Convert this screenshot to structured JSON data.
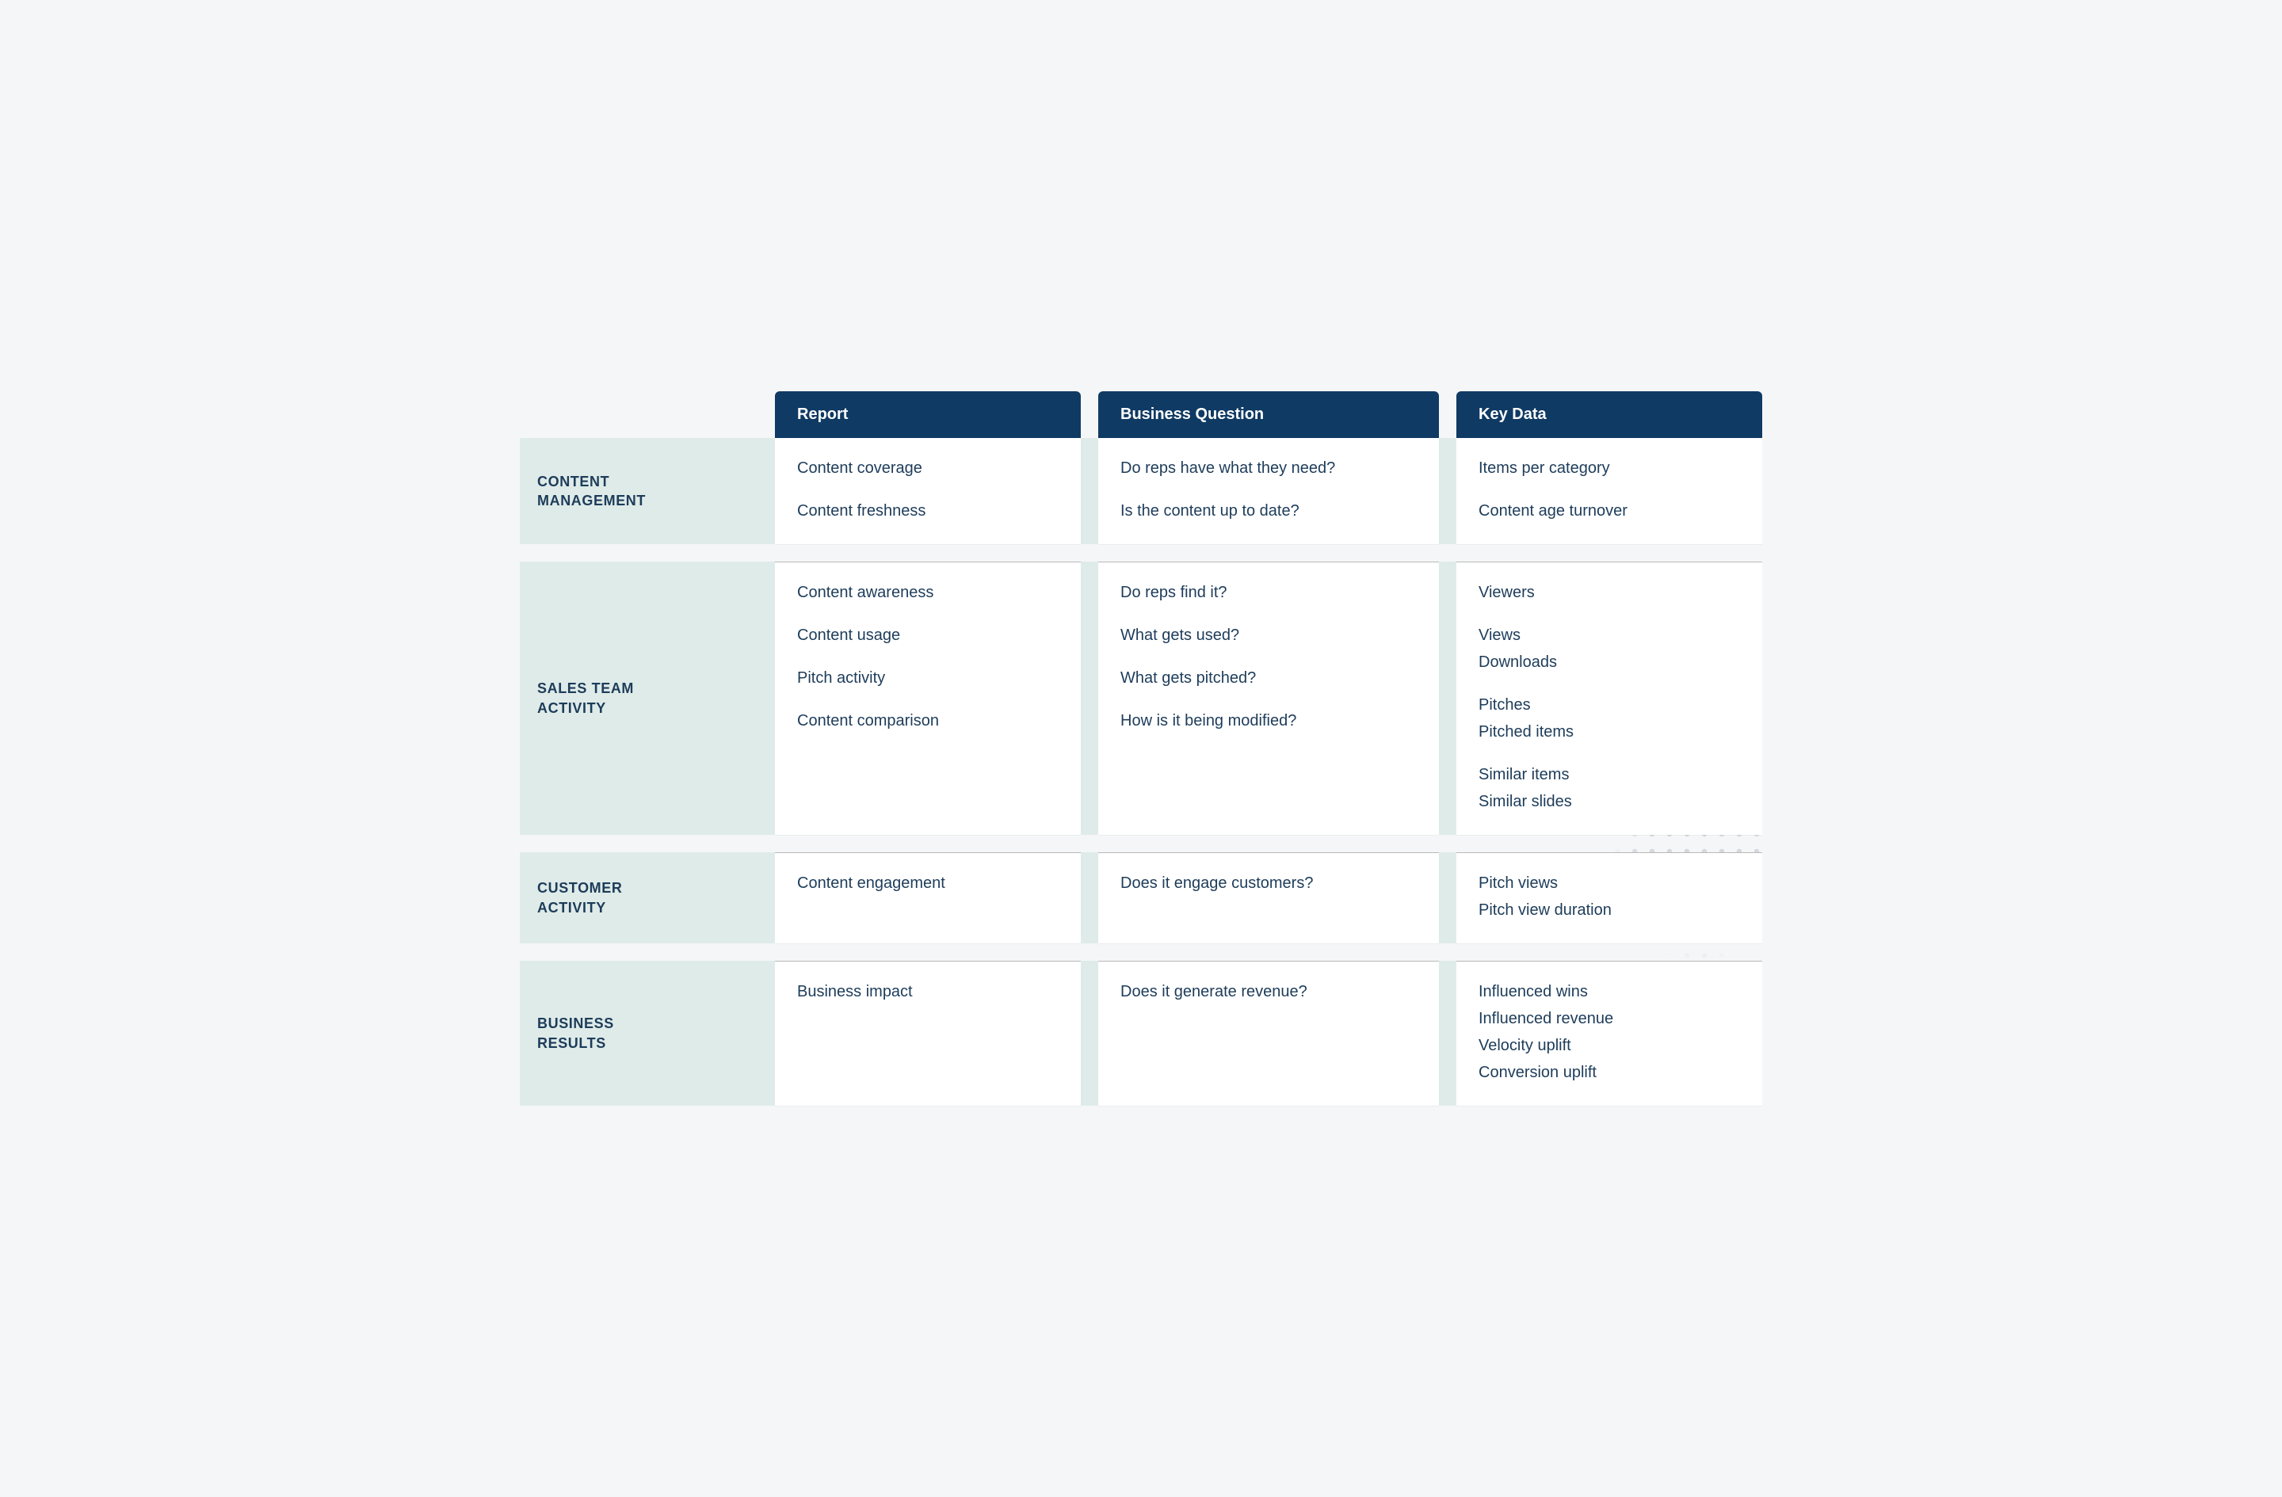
{
  "columns": {
    "report": "Report",
    "question": "Business Question",
    "keydata": "Key Data"
  },
  "categories": [
    {
      "label": "CONTENT\nMANAGEMENT",
      "rows": [
        {
          "report": "Content coverage",
          "question": "Do reps have what they need?",
          "keydata": [
            "Items per category"
          ]
        },
        {
          "report": "Content freshness",
          "question": "Is the content up to date?",
          "keydata": [
            "Content age turnover"
          ]
        }
      ]
    },
    {
      "label": "SALES TEAM\nACTIVITY",
      "rows": [
        {
          "report": "Content awareness",
          "question": "Do reps find it?",
          "keydata": [
            "Viewers"
          ]
        },
        {
          "report": "Content usage",
          "question": "What gets used?",
          "keydata": [
            "Views",
            "Downloads"
          ]
        },
        {
          "report": "Pitch activity",
          "question": "What gets pitched?",
          "keydata": [
            "Pitches",
            "Pitched items"
          ]
        },
        {
          "report": "Content comparison",
          "question": "How is it being modified?",
          "keydata": [
            "Similar items",
            "Similar slides"
          ]
        }
      ]
    },
    {
      "label": "CUSTOMER\nACTIVITY",
      "rows": [
        {
          "report": "Content engagement",
          "question": "Does it engage customers?",
          "keydata": [
            "Pitch views",
            "Pitch view duration"
          ]
        }
      ]
    },
    {
      "label": "BUSINESS\nRESULTS",
      "rows": [
        {
          "report": "Business impact",
          "question": "Does it generate revenue?",
          "keydata": [
            "Influenced wins",
            "Influenced revenue",
            "Velocity uplift",
            "Conversion uplift"
          ]
        }
      ]
    }
  ]
}
